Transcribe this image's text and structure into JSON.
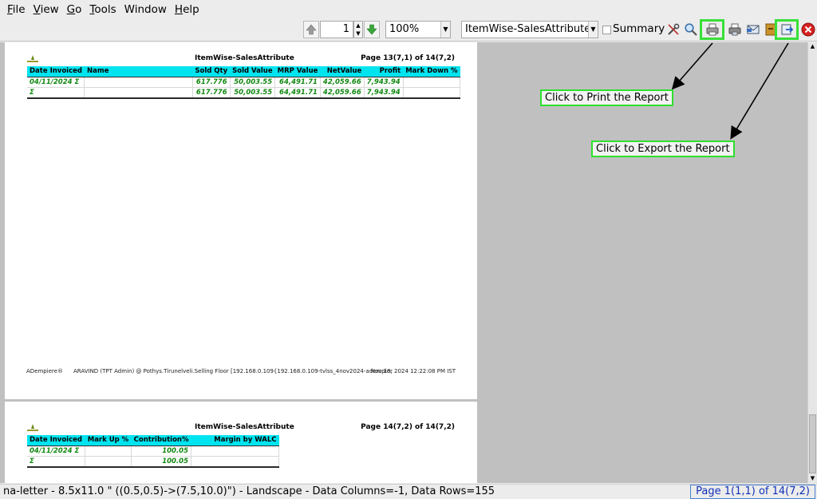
{
  "menubar": [
    {
      "key": "F",
      "rest": "ile"
    },
    {
      "key": "V",
      "rest": "iew"
    },
    {
      "key": "G",
      "rest": "o"
    },
    {
      "key": "T",
      "rest": "ools"
    },
    {
      "key": "",
      "rest": "Window"
    },
    {
      "key": "H",
      "rest": "elp"
    }
  ],
  "toolbar": {
    "page_number": "1",
    "zoom": "100%",
    "report_format": "ItemWise-SalesAttribute",
    "summary_label": "Summary",
    "summary_checked": false
  },
  "report": {
    "title": "ItemWise-SalesAttribute",
    "page1": {
      "page_label": "Page 13(7,1) of 14(7,2)",
      "columns": [
        "Date Invoiced",
        "Name",
        "Sold Qty",
        "Sold Value",
        "MRP Value",
        "NetValue",
        "Profit",
        "Mark Down %"
      ],
      "rows": [
        [
          "04/11/2024 Σ",
          "",
          "617.776",
          "50,003.55",
          "64,491.71",
          "42,059.66",
          "7,943.94",
          ""
        ],
        [
          "Σ",
          "",
          "617.776",
          "50,003.55",
          "64,491.71",
          "42,059.66",
          "7,943.94",
          ""
        ]
      ],
      "footer_left": "ADempiere®",
      "footer_mid": "ARAVIND (TPT Admin) @ Pothys.Tirunelveli.Selling Floor [192.168.0.109{192.168.0.109-tvlss_4nov2024-adempiere}]",
      "footer_right": "Nov 13, 2024 12:22:08 PM IST"
    },
    "page2": {
      "page_label": "Page 14(7,2) of 14(7,2)",
      "columns": [
        "Date Invoiced",
        "Mark Up %",
        "Contribution%",
        "Margin by WALC"
      ],
      "rows": [
        [
          "04/11/2024 Σ",
          "",
          "100.05",
          ""
        ],
        [
          "Σ",
          "",
          "100.05",
          ""
        ]
      ]
    }
  },
  "callouts": {
    "print": "Click to Print the Report",
    "export": "Click to Export the Report"
  },
  "status": {
    "left": "na-letter - 8.5x11.0 \" ((0.5,0.5)->(7.5,10.0)\") - Landscape - Data Columns=-1, Data Rows=155",
    "right": "Page 1(1,1) of 14(7,2)"
  },
  "colors": {
    "header_cyan": "#00e4f0",
    "data_green": "#118811",
    "highlight_green": "#38e038"
  }
}
